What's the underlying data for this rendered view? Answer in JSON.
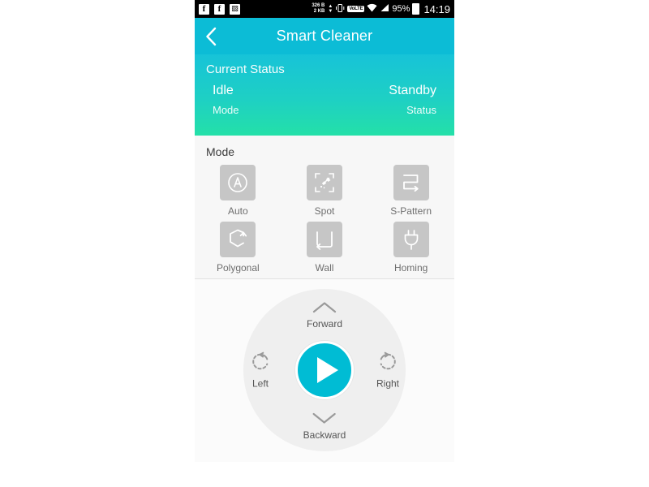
{
  "statusbar": {
    "icons": [
      "facebook-icon",
      "facebook-icon",
      "photo-icon"
    ],
    "data_up": "326 B",
    "data_down": "2 KB",
    "arrow_up": "▲",
    "arrow_down": "▼",
    "vibrate_icon": "vibrate-icon",
    "network_label": "VoLTE",
    "wifi_icon": "wifi-icon",
    "signal_icon": "signal-icon",
    "battery_percent": "95%",
    "battery_icon": "battery-full-icon",
    "time": "14:19"
  },
  "appbar": {
    "back_icon": "chevron-left-icon",
    "title": "Smart Cleaner",
    "background_color": "#0cbcd6"
  },
  "status_panel": {
    "title": "Current Status",
    "mode_value": "Idle",
    "status_value": "Standby",
    "mode_label": "Mode",
    "status_label": "Status",
    "gradient_from": "#17c3d8",
    "gradient_to": "#24e0a8"
  },
  "mode_section": {
    "heading": "Mode",
    "items": [
      {
        "label": "Auto",
        "icon": "auto-circle-a-icon"
      },
      {
        "label": "Spot",
        "icon": "spot-brush-icon"
      },
      {
        "label": "S-Pattern",
        "icon": "s-pattern-arrow-icon"
      },
      {
        "label": "Polygonal",
        "icon": "polygonal-loop-icon"
      },
      {
        "label": "Wall",
        "icon": "wall-follow-icon"
      },
      {
        "label": "Homing",
        "icon": "power-plug-icon"
      }
    ],
    "tile_color": "#c6c6c6"
  },
  "control_pad": {
    "forward": {
      "label": "Forward",
      "icon": "chevron-up-icon"
    },
    "backward": {
      "label": "Backward",
      "icon": "chevron-down-icon"
    },
    "left": {
      "label": "Left",
      "icon": "rotate-left-icon"
    },
    "right": {
      "label": "Right",
      "icon": "rotate-right-icon"
    },
    "play": {
      "label": "",
      "icon": "play-icon",
      "color": "#00bcd4"
    }
  }
}
